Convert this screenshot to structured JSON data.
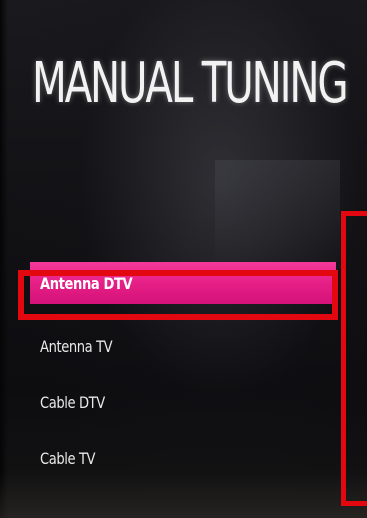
{
  "screen": {
    "title": "MANUAL TUNING"
  },
  "menu": {
    "items": [
      {
        "label": "Antenna DTV",
        "selected": true
      },
      {
        "label": "Antenna TV",
        "selected": false
      },
      {
        "label": "Cable DTV",
        "selected": false
      },
      {
        "label": "Cable TV",
        "selected": false
      }
    ]
  },
  "colors": {
    "selection": "#e61f86",
    "annotation": "#e3080f",
    "text": "#e8e8e8"
  }
}
